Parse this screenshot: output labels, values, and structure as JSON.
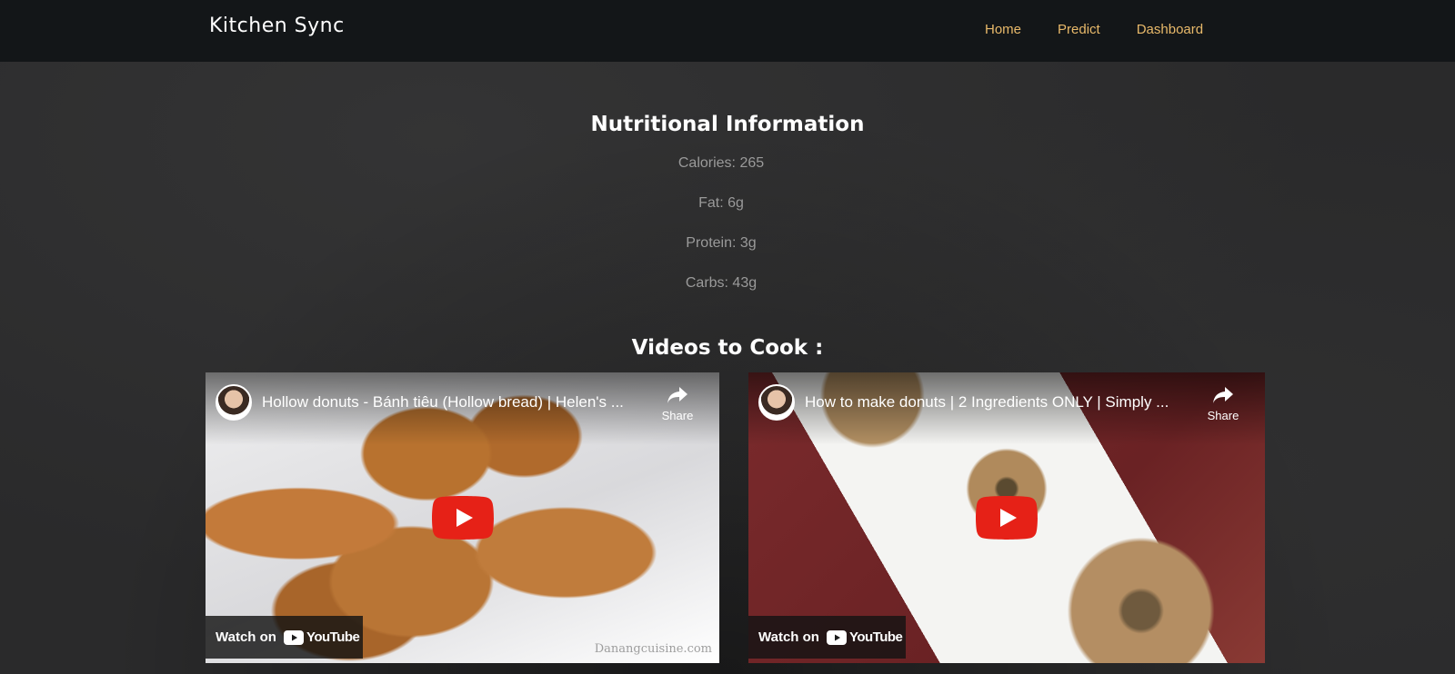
{
  "navbar": {
    "brand": "Kitchen Sync",
    "links": [
      "Home",
      "Predict",
      "Dashboard"
    ]
  },
  "nutrition": {
    "title": "Nutritional Information",
    "items": [
      "Calories: 265",
      "Fat: 6g",
      "Protein: 3g",
      "Carbs: 43g"
    ]
  },
  "videos": {
    "title": "Videos to Cook :",
    "items": [
      {
        "title": "Hollow donuts - Bánh tiêu (Hollow bread) | Helen's ...",
        "share_label": "Share",
        "watch_label": "Watch on",
        "youtube_label": "YouTube",
        "watermark": "Danangcuisine.com"
      },
      {
        "title": "How to make donuts | 2 Ingredients ONLY | Simply ...",
        "share_label": "Share",
        "watch_label": "Watch on",
        "youtube_label": "YouTube"
      }
    ]
  },
  "colors": {
    "navbar_bg": "#131618",
    "nav_link": "#e8b96a",
    "youtube_red": "#e62117"
  }
}
